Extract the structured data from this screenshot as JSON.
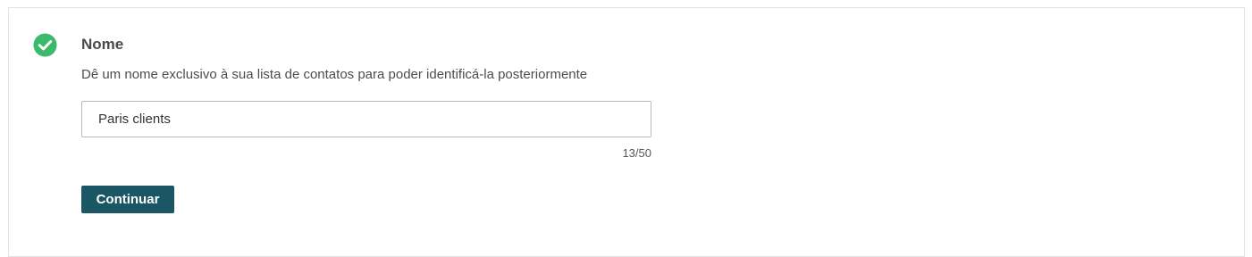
{
  "step": {
    "status_icon": "check-circle-icon",
    "status_color": "#3cb96a",
    "title": "Nome",
    "description": "Dê um nome exclusivo à sua lista de contatos para poder identificá-la posteriormente"
  },
  "name_field": {
    "value": "Paris clients",
    "placeholder": "",
    "counter": "13/50",
    "max_length": 50
  },
  "actions": {
    "continue_label": "Continuar",
    "button_color": "#1b5665"
  }
}
